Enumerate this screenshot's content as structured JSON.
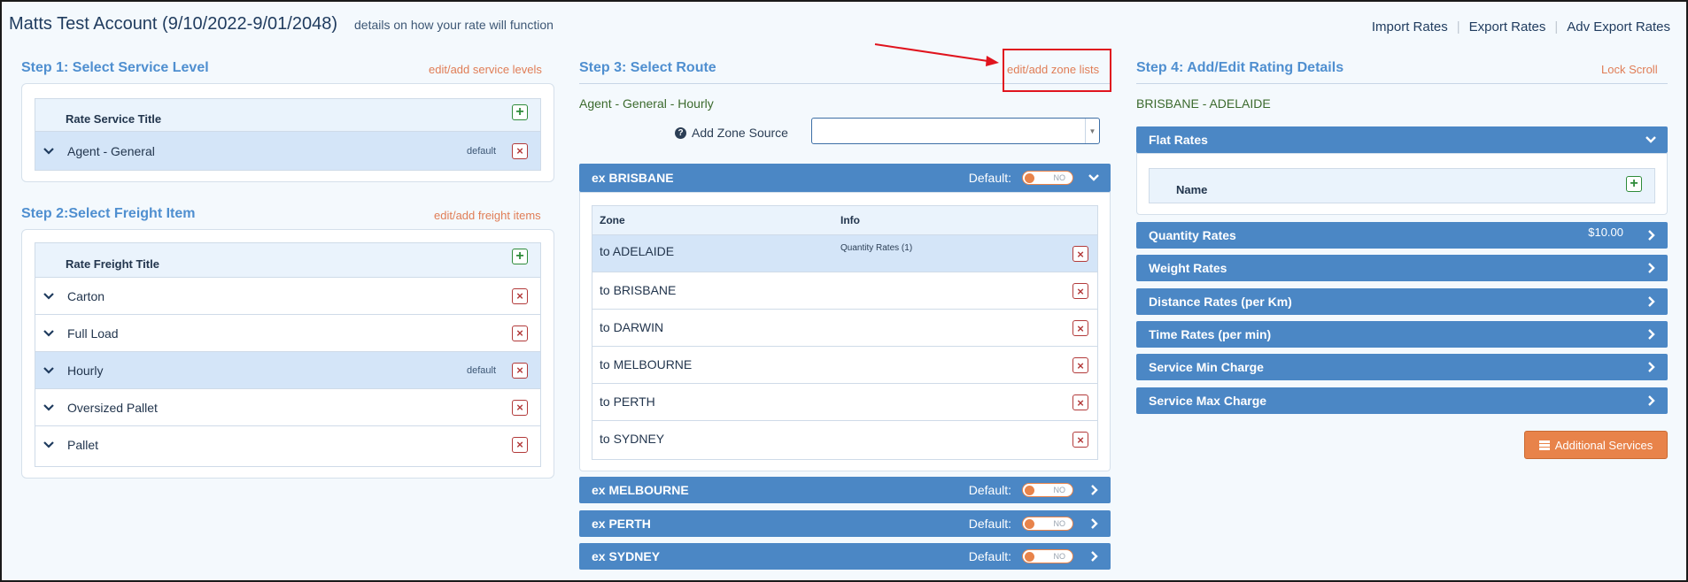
{
  "header": {
    "title": "Matts Test Account (9/10/2022-9/01/2048)",
    "subtitle": "details on how your rate will function",
    "links": [
      "Import Rates",
      "Export Rates",
      "Adv Export Rates"
    ]
  },
  "step1": {
    "title": "Step 1: Select Service Level",
    "link": "edit/add service levels",
    "column": "Rate Service Title",
    "rows": [
      {
        "label": "Agent - General",
        "tag": "default"
      }
    ]
  },
  "step2": {
    "title": "Step 2:Select Freight Item",
    "link": "edit/add freight items",
    "column": "Rate Freight Title",
    "rows": [
      {
        "label": "Carton",
        "tag": ""
      },
      {
        "label": "Full Load",
        "tag": ""
      },
      {
        "label": "Hourly",
        "tag": "default"
      },
      {
        "label": "Oversized Pallet",
        "tag": ""
      },
      {
        "label": "Pallet",
        "tag": ""
      }
    ]
  },
  "step3": {
    "title": "Step 3: Select Route",
    "link": "edit/add zone lists",
    "route": "Agent - General - Hourly",
    "zone_source_label": "Add Zone Source",
    "zone_source_value": "",
    "default_label": "Default:",
    "toggle_text": "NO",
    "expanded": {
      "title": "ex BRISBANE",
      "col_zone": "Zone",
      "col_info": "Info",
      "rows": [
        {
          "zone": "to ADELAIDE",
          "info": "Quantity Rates (1)"
        },
        {
          "zone": "to BRISBANE",
          "info": ""
        },
        {
          "zone": "to DARWIN",
          "info": ""
        },
        {
          "zone": "to MELBOURNE",
          "info": ""
        },
        {
          "zone": "to PERTH",
          "info": ""
        },
        {
          "zone": "to SYDNEY",
          "info": ""
        }
      ]
    },
    "collapsed": [
      "ex MELBOURNE",
      "ex PERTH",
      "ex SYDNEY"
    ]
  },
  "step4": {
    "title": "Step 4: Add/Edit Rating Details",
    "link": "Lock Scroll",
    "route": "BRISBANE - ADELAIDE",
    "flat_rates": {
      "title": "Flat Rates",
      "column": "Name"
    },
    "sections": [
      {
        "title": "Quantity Rates",
        "value": "$10.00"
      },
      {
        "title": "Weight Rates",
        "value": ""
      },
      {
        "title": "Distance Rates (per Km)",
        "value": ""
      },
      {
        "title": "Time Rates (per min)",
        "value": ""
      },
      {
        "title": "Service Min Charge",
        "value": ""
      },
      {
        "title": "Service Max Charge",
        "value": ""
      }
    ],
    "additional_button": "Additional Services"
  },
  "colors": {
    "accent_blue": "#4b87c5",
    "link_orange": "#e07d56",
    "annotation_red": "#e0141e"
  }
}
